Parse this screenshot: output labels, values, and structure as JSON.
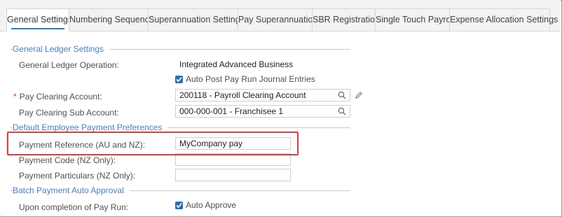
{
  "tabs": [
    {
      "label": "General Settings",
      "active": true
    },
    {
      "label": "Numbering Sequence",
      "active": false
    },
    {
      "label": "Superannuation Settings",
      "active": false
    },
    {
      "label": "Pay Superannuation",
      "active": false
    },
    {
      "label": "SBR Registration",
      "active": false
    },
    {
      "label": "Single Touch Payroll",
      "active": false
    },
    {
      "label": "Expense Allocation Settings",
      "active": false
    }
  ],
  "general_ledger": {
    "title": "General Ledger Settings",
    "operation_label": "General Ledger Operation:",
    "operation_value": "Integrated Advanced Business",
    "auto_post_label": "Auto Post Pay Run Journal Entries",
    "auto_post_checked": true,
    "clearing_required_mark": "*",
    "clearing_label": "Pay Clearing Account:",
    "clearing_value": "200118 - Payroll Clearing Account",
    "sub_account_label": "Pay Clearing Sub Account:",
    "sub_account_value": "000-000-001 - Franchisee 1"
  },
  "payment_prefs": {
    "title": "Default Employee Payment Preferences",
    "reference_label": "Payment Reference (AU and NZ):",
    "reference_value": "MyCompany pay",
    "code_label": "Payment Code (NZ Only):",
    "code_value": "",
    "particulars_label": "Payment Particulars (NZ Only):",
    "particulars_value": ""
  },
  "batch_approval": {
    "title": "Batch Payment Auto Approval",
    "completion_label": "Upon completion of Pay Run:",
    "auto_approve_label": "Auto Approve",
    "auto_approve_checked": true
  },
  "colors": {
    "accent": "#2a7bc8",
    "section_title": "#4a7fb5",
    "highlight": "#c44b4b"
  }
}
